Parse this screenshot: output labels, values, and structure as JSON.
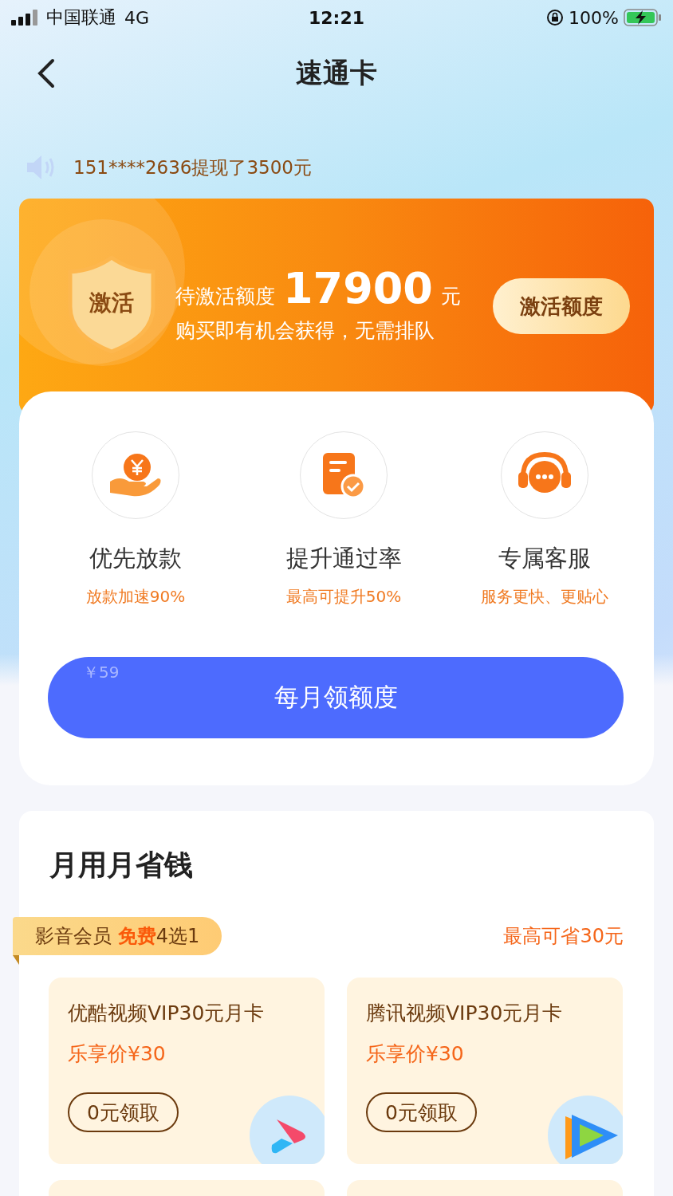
{
  "status_bar": {
    "carrier": "中国联通",
    "network": "4G",
    "time": "12:21",
    "battery": "100%"
  },
  "nav": {
    "title": "速通卡"
  },
  "ticker": {
    "text": "151****2636提现了3500元"
  },
  "banner": {
    "badge": "激活",
    "label": "待激活额度",
    "amount": "17900",
    "unit": "元",
    "subtitle": "购买即有机会获得，无需排队",
    "button": "激活额度"
  },
  "benefits": [
    {
      "kind": "money",
      "title": "优先放款",
      "desc": "放款加速90%"
    },
    {
      "kind": "doc",
      "title": "提升通过率",
      "desc": "最高可提升50%"
    },
    {
      "kind": "service",
      "title": "专属客服",
      "desc": "服务更快、更贴心"
    }
  ],
  "cta": {
    "price": "￥59",
    "label": "每月领额度"
  },
  "savings": {
    "title": "月用月省钱",
    "tag": {
      "prefix": "影音会员 ",
      "highlight": "免费",
      "suffix": "4选1"
    },
    "max_save": "最高可省30元",
    "offers": [
      {
        "kind": "youku",
        "name": "优酷视频VIP30元月卡",
        "price": "乐享价¥30",
        "button": "0元领取"
      },
      {
        "kind": "tencent",
        "name": "腾讯视频VIP30元月卡",
        "price": "乐享价¥30",
        "button": "0元领取"
      }
    ]
  }
}
